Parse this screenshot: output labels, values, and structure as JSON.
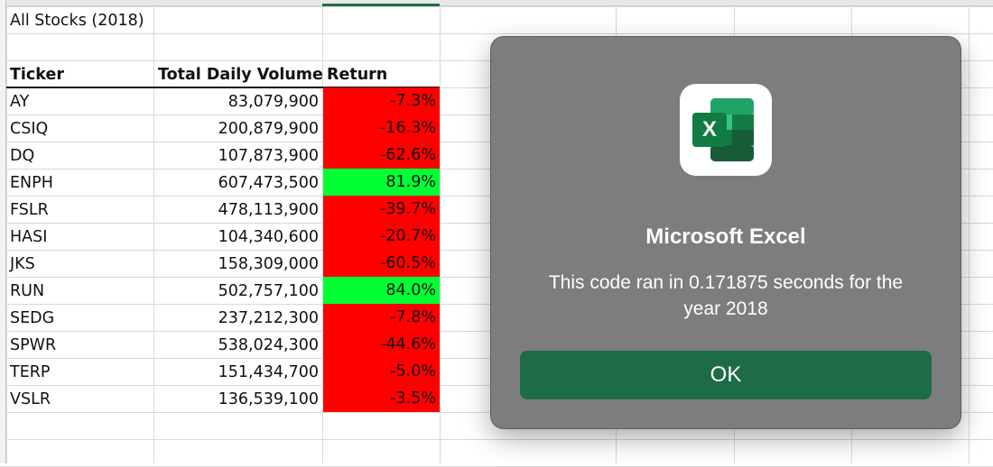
{
  "sheet": {
    "title": "All Stocks (2018)",
    "headers": {
      "ticker": "Ticker",
      "volume": "Total Daily Volume",
      "return": "Return"
    },
    "rows": [
      {
        "ticker": "AY",
        "volume": "83,079,900",
        "return": "-7.3%",
        "status": "negative"
      },
      {
        "ticker": "CSIQ",
        "volume": "200,879,900",
        "return": "-16.3%",
        "status": "negative"
      },
      {
        "ticker": "DQ",
        "volume": "107,873,900",
        "return": "-62.6%",
        "status": "negative"
      },
      {
        "ticker": "ENPH",
        "volume": "607,473,500",
        "return": "81.9%",
        "status": "positive"
      },
      {
        "ticker": "FSLR",
        "volume": "478,113,900",
        "return": "-39.7%",
        "status": "negative"
      },
      {
        "ticker": "HASI",
        "volume": "104,340,600",
        "return": "-20.7%",
        "status": "negative"
      },
      {
        "ticker": "JKS",
        "volume": "158,309,000",
        "return": "-60.5%",
        "status": "negative"
      },
      {
        "ticker": "RUN",
        "volume": "502,757,100",
        "return": "84.0%",
        "status": "positive"
      },
      {
        "ticker": "SEDG",
        "volume": "237,212,300",
        "return": "-7.8%",
        "status": "negative"
      },
      {
        "ticker": "SPWR",
        "volume": "538,024,300",
        "return": "-44.6%",
        "status": "negative"
      },
      {
        "ticker": "TERP",
        "volume": "151,434,700",
        "return": "-5.0%",
        "status": "negative"
      },
      {
        "ticker": "VSLR",
        "volume": "136,539,100",
        "return": "-3.5%",
        "status": "negative"
      }
    ]
  },
  "colors": {
    "positive": "#00ff33",
    "negative": "#ff0000",
    "ok_button": "#1e6b48",
    "dialog_bg": "#7d7d7f",
    "excel_green": "#107c41"
  },
  "dialog": {
    "icon": "excel-app-icon",
    "icon_letter": "X",
    "title": "Microsoft Excel",
    "message": "This code ran in 0.171875 seconds for the year 2018",
    "ok_label": "OK"
  }
}
